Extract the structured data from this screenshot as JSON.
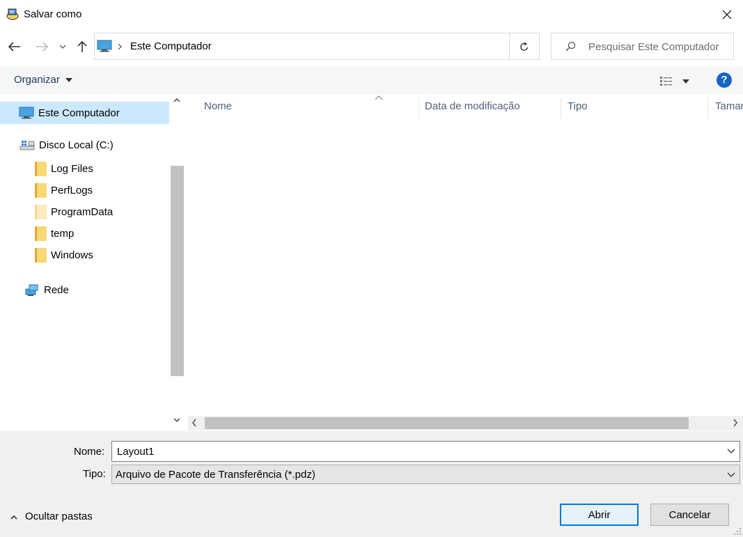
{
  "window": {
    "title": "Salvar como",
    "app_icon": "save-app-icon",
    "close_icon": "close-icon"
  },
  "address": {
    "path_root": "Este Computador",
    "search_placeholder": "Pesquisar Este Computador"
  },
  "toolbar": {
    "organize_label": "Organizar",
    "help_label": "?"
  },
  "nav": {
    "items": [
      {
        "label": "Este Computador",
        "icon": "computer-icon",
        "selected": true
      },
      {
        "label": "Disco Local (C:)",
        "icon": "drive-icon"
      },
      {
        "label": "Log Files",
        "icon": "folder-icon"
      },
      {
        "label": "PerfLogs",
        "icon": "folder-icon"
      },
      {
        "label": "ProgramData",
        "icon": "folder-icon"
      },
      {
        "label": "temp",
        "icon": "folder-icon"
      },
      {
        "label": "Windows",
        "icon": "folder-icon"
      },
      {
        "label": "Rede",
        "icon": "network-icon"
      }
    ]
  },
  "list": {
    "columns": [
      "Nome",
      "Data de modificação",
      "Tipo",
      "Taman"
    ]
  },
  "footer": {
    "name_label": "Nome:",
    "name_value": "Layout1",
    "type_label": "Tipo:",
    "type_value": "Arquivo de Pacote de Transferência (*.pdz)",
    "hide_folders_label": "Ocultar pastas",
    "open_button": "Abrir",
    "cancel_button": "Cancelar"
  }
}
